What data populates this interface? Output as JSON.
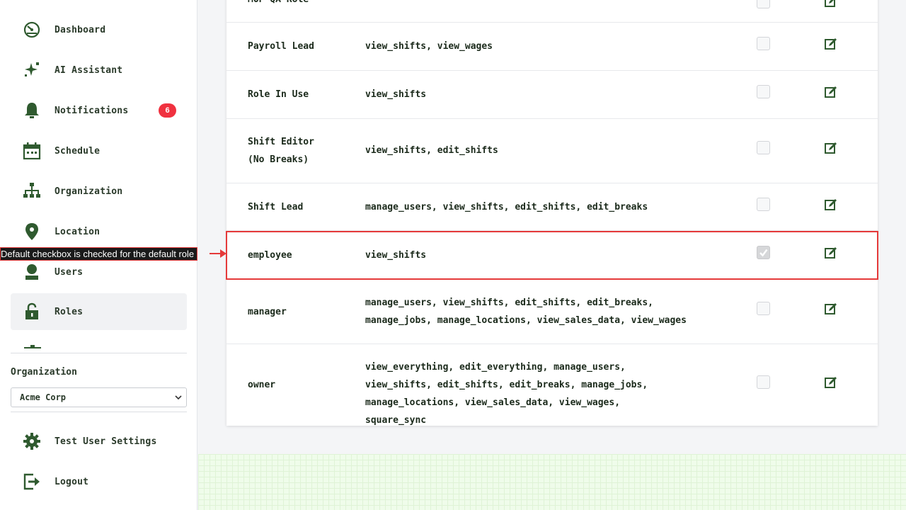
{
  "sidebar": {
    "items": [
      {
        "label": "Dashboard",
        "icon": "dashboard-icon"
      },
      {
        "label": "AI Assistant",
        "icon": "sparkle-icon"
      },
      {
        "label": "Notifications",
        "icon": "bell-icon",
        "badge": "6"
      },
      {
        "label": "Schedule",
        "icon": "calendar-icon"
      },
      {
        "label": "Organization",
        "icon": "org-chart-icon"
      },
      {
        "label": "Location",
        "icon": "map-pin-icon"
      },
      {
        "label": "Users",
        "icon": "user-icon"
      },
      {
        "label": "Roles",
        "icon": "lock-icon",
        "active": true
      }
    ],
    "organization_label": "Organization",
    "organization_select_value": "Acme Corp",
    "footer_items": [
      {
        "label": "Test User Settings",
        "icon": "gear-icon"
      },
      {
        "label": "Logout",
        "icon": "logout-icon"
      }
    ]
  },
  "roles_table": {
    "partial_top_row_name": "MOP QA Role",
    "rows": [
      {
        "name": "Payroll Lead",
        "permissions": "view_shifts, view_wages",
        "default": false
      },
      {
        "name": "Role In Use",
        "permissions": "view_shifts",
        "default": false
      },
      {
        "name": "Shift Editor (No Breaks)",
        "permissions": "view_shifts, edit_shifts",
        "default": false
      },
      {
        "name": "Shift Lead",
        "permissions": "manage_users, view_shifts, edit_shifts, edit_breaks",
        "default": false
      },
      {
        "name": "employee",
        "permissions": "view_shifts",
        "default": true
      },
      {
        "name": "manager",
        "permissions": "manage_users, view_shifts, edit_shifts, edit_breaks, manage_jobs, manage_locations, view_sales_data, view_wages",
        "default": false
      },
      {
        "name": "owner",
        "permissions": "view_everything, edit_everything, manage_users, view_shifts, edit_shifts, edit_breaks, manage_jobs, manage_locations, view_sales_data, view_wages, square_sync",
        "default": false
      }
    ]
  },
  "annotation": {
    "text": "Default checkbox is checked for the default role"
  },
  "colors": {
    "icon_green": "#2f5a2f",
    "badge_red": "#f0313f",
    "highlight_red": "#e53a3a"
  }
}
